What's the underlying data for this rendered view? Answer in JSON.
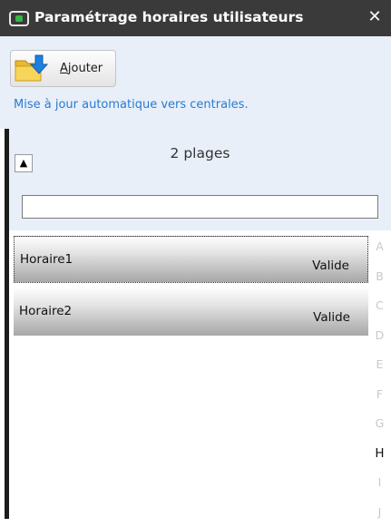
{
  "window": {
    "title": "Paramétrage horaires utilisateurs",
    "close_symbol": "✕",
    "title_icon": "screen-icon"
  },
  "toolbar": {
    "add_label_first": "A",
    "add_label_rest": "jouter",
    "add_icon": "folder-download-icon",
    "auto_update_text": "Mise à jour automatique vers centrales."
  },
  "list": {
    "collapse_symbol": "▲",
    "count_label": "2 plages",
    "search_value": "",
    "items": [
      {
        "name": "Horaire1",
        "status": "Valide",
        "selected": true
      },
      {
        "name": "Horaire2",
        "status": "Valide",
        "selected": false
      }
    ],
    "alphabet": [
      "A",
      "B",
      "C",
      "D",
      "E",
      "F",
      "G",
      "H",
      "I",
      "J"
    ],
    "active_letter": "H"
  },
  "colors": {
    "titlebar": "#3a3a3a",
    "toolbar_bg": "#e8eff9",
    "link_blue": "#2a7ad0",
    "accent_green": "#39b54a"
  }
}
